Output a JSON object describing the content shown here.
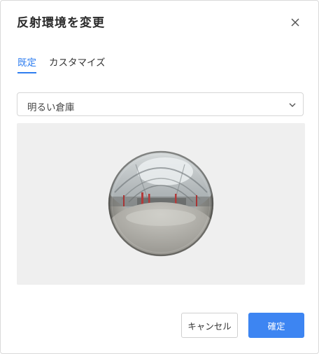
{
  "dialog": {
    "title": "反射環境を変更",
    "close_icon": "close-icon"
  },
  "tabs": [
    {
      "label": "既定",
      "active": true
    },
    {
      "label": "カスタマイズ",
      "active": false
    }
  ],
  "environment_select": {
    "selected": "明るい倉庫",
    "chevron_icon": "chevron-down-icon"
  },
  "buttons": {
    "cancel_label": "キャンセル",
    "confirm_label": "確定"
  },
  "colors": {
    "accent": "#3d85f2",
    "preview_bg": "#efefef"
  }
}
